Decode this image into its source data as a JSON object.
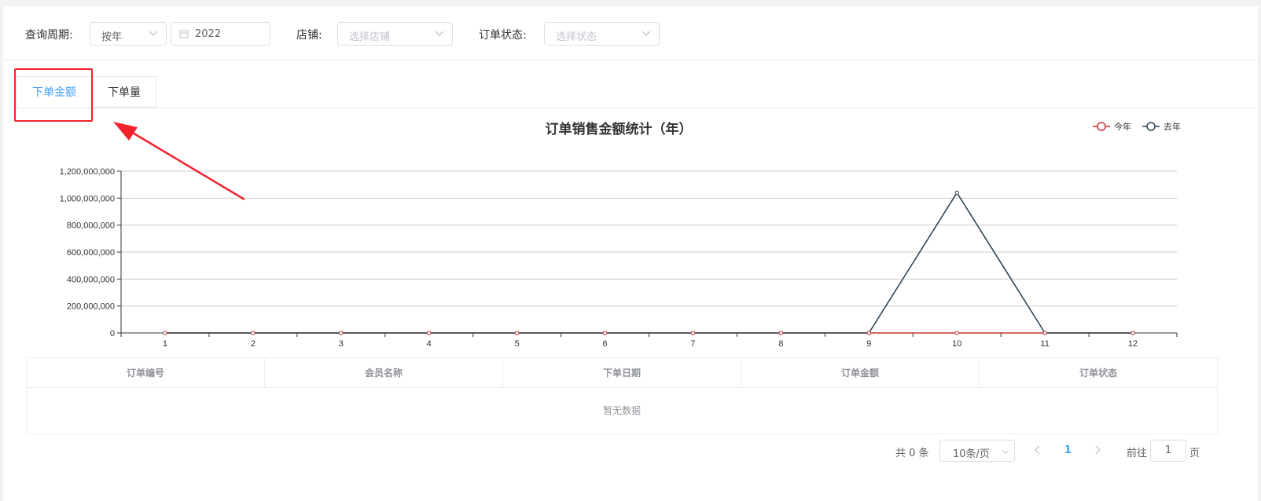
{
  "filters": {
    "period_label": "查询周期:",
    "period_value": "按年",
    "year_value": "2022",
    "store_label": "店铺:",
    "store_placeholder": "选择店铺",
    "status_label": "订单状态:",
    "status_placeholder": "选择状态"
  },
  "tabs": [
    {
      "label": "下单金额",
      "active": true
    },
    {
      "label": "下单量",
      "active": false
    }
  ],
  "chart_data": {
    "type": "line",
    "title": "订单销售金额统计（年）",
    "x": [
      "1",
      "2",
      "3",
      "4",
      "5",
      "6",
      "7",
      "8",
      "9",
      "10",
      "11",
      "12"
    ],
    "y_ticks": [
      "0",
      "200,000,000",
      "400,000,000",
      "600,000,000",
      "800,000,000",
      "1,000,000,000",
      "1,200,000,000"
    ],
    "ylim": [
      0,
      1200000000
    ],
    "legend_position": "top-right",
    "series": [
      {
        "name": "今年",
        "color": "#c23531",
        "values": [
          0,
          0,
          0,
          0,
          0,
          0,
          0,
          0,
          0,
          0,
          0,
          0
        ]
      },
      {
        "name": "去年",
        "color": "#2f4554",
        "values": [
          0,
          0,
          0,
          0,
          0,
          0,
          0,
          0,
          0,
          1040000000,
          0,
          0
        ]
      }
    ]
  },
  "table": {
    "columns": [
      "订单编号",
      "会员名称",
      "下单日期",
      "订单金额",
      "订单状态"
    ],
    "empty_text": "暂无数据"
  },
  "pagination": {
    "total_text": "共 0 条",
    "page_size": "10条/页",
    "current_page": "1",
    "goto_label": "前往",
    "goto_value": "1",
    "page_suffix": "页"
  },
  "colors": {
    "accent": "#409eff",
    "annotation": "#f5222d"
  }
}
